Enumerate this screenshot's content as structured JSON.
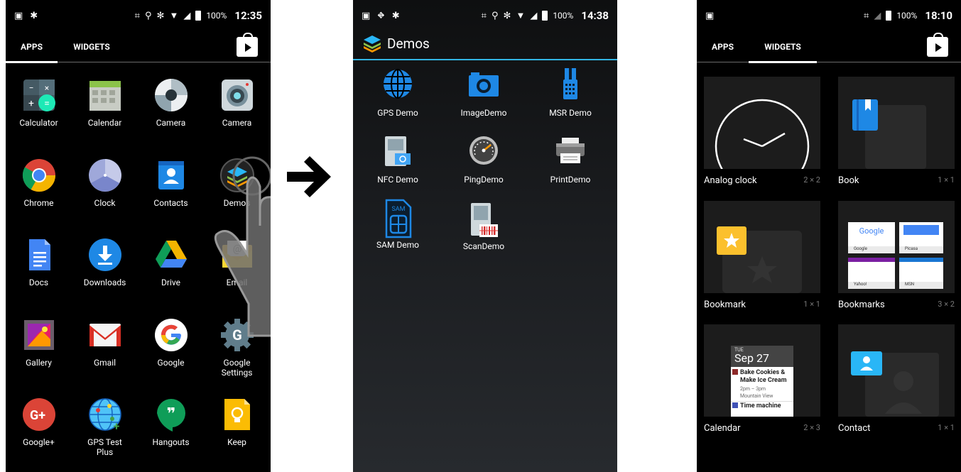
{
  "phone1": {
    "status": {
      "battery": "100%",
      "time": "12:35"
    },
    "tabs": {
      "apps": "APPS",
      "widgets": "WIDGETS"
    },
    "apps": [
      {
        "label": "Calculator",
        "icon": "calculator-icon"
      },
      {
        "label": "Calendar",
        "icon": "calendar-icon"
      },
      {
        "label": "Camera",
        "icon": "camera-icon"
      },
      {
        "label": "Camera",
        "icon": "camera-lens-icon"
      },
      {
        "label": "Chrome",
        "icon": "chrome-icon"
      },
      {
        "label": "Clock",
        "icon": "clock-icon"
      },
      {
        "label": "Contacts",
        "icon": "contacts-icon"
      },
      {
        "label": "Demos",
        "icon": "demos-icon"
      },
      {
        "label": "Docs",
        "icon": "docs-icon"
      },
      {
        "label": "Downloads",
        "icon": "downloads-icon"
      },
      {
        "label": "Drive",
        "icon": "drive-icon"
      },
      {
        "label": "Email",
        "icon": "email-icon"
      },
      {
        "label": "Gallery",
        "icon": "gallery-icon"
      },
      {
        "label": "Gmail",
        "icon": "gmail-icon"
      },
      {
        "label": "Google",
        "icon": "google-icon"
      },
      {
        "label": "Google Settings",
        "icon": "google-settings-icon"
      },
      {
        "label": "Google+",
        "icon": "google-plus-icon"
      },
      {
        "label": "GPS Test Plus",
        "icon": "gps-test-icon"
      },
      {
        "label": "Hangouts",
        "icon": "hangouts-icon"
      },
      {
        "label": "Keep",
        "icon": "keep-icon"
      }
    ]
  },
  "phone2": {
    "status": {
      "battery": "100%",
      "time": "14:38"
    },
    "title": "Demos",
    "demos": [
      {
        "label": "GPS Demo",
        "icon": "globe-icon"
      },
      {
        "label": "ImageDemo",
        "icon": "camera-icon"
      },
      {
        "label": "MSR Demo",
        "icon": "card-reader-icon"
      },
      {
        "label": "NFC Demo",
        "icon": "nfc-terminal-icon"
      },
      {
        "label": "PingDemo",
        "icon": "gauge-icon"
      },
      {
        "label": "PrintDemo",
        "icon": "printer-icon"
      },
      {
        "label": "SAM Demo",
        "icon": "sim-card-icon"
      },
      {
        "label": "ScanDemo",
        "icon": "barcode-scanner-icon"
      }
    ]
  },
  "phone3": {
    "status": {
      "battery": "100%",
      "time": "18:10"
    },
    "tabs": {
      "apps": "APPS",
      "widgets": "WIDGETS"
    },
    "widgets": [
      {
        "label": "Analog clock",
        "size": "2 × 2"
      },
      {
        "label": "Book",
        "size": "1 × 1"
      },
      {
        "label": "Bookmark",
        "size": "1 × 1"
      },
      {
        "label": "Bookmarks",
        "size": "3 × 2"
      },
      {
        "label": "Calendar",
        "size": "2 × 3"
      },
      {
        "label": "Contact",
        "size": "1 × 1"
      }
    ],
    "calendar_preview": {
      "day": "TUE",
      "date": "Sep 27",
      "event1_title": "Bake Cookies & Make Ice Cream",
      "event1_time": "2pm – 3pm",
      "event1_place": "Mountain View",
      "event2_title": "Time machine"
    },
    "bookmarks_preview": {
      "google": "Google",
      "picasa": "Picasa",
      "yahoo": "Yahoo!",
      "msn": "MSN"
    }
  },
  "colors": {
    "accent_blue": "#33b5e5",
    "background": "#000000"
  }
}
